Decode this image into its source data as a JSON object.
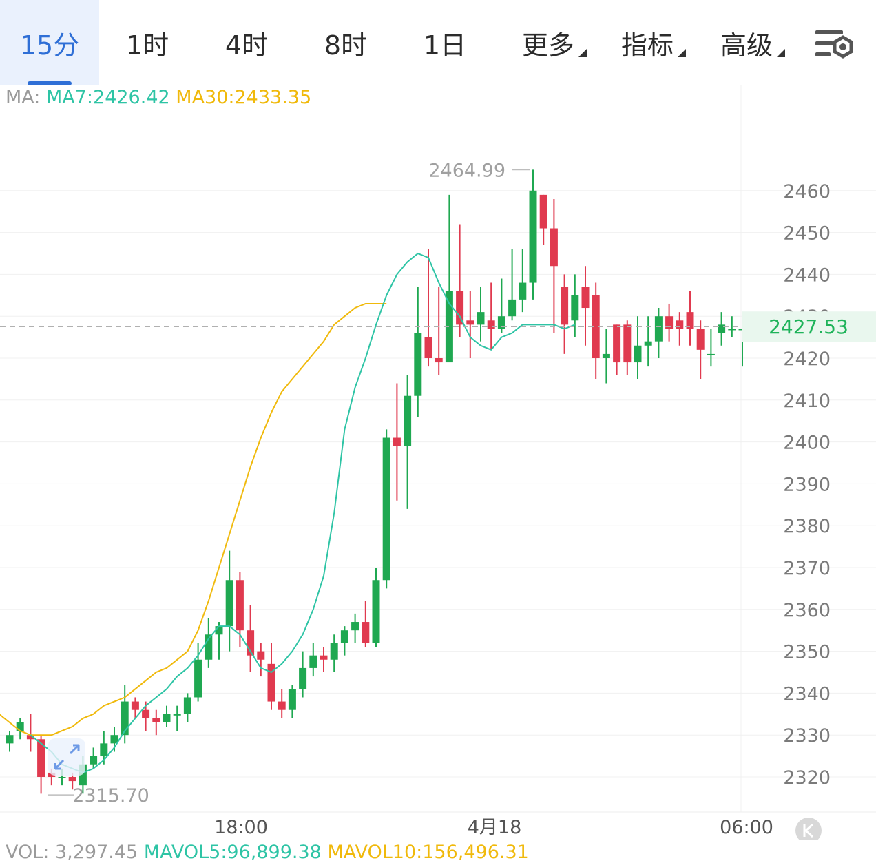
{
  "tabs": [
    {
      "label": "15分",
      "active": true
    },
    {
      "label": "1时"
    },
    {
      "label": "4时"
    },
    {
      "label": "8时"
    },
    {
      "label": "1日"
    },
    {
      "label": "更多",
      "dropdown": true
    },
    {
      "label": "指标",
      "dropdown": true
    },
    {
      "label": "高级",
      "dropdown": true
    }
  ],
  "settings_icon": "chart-settings-icon",
  "ma": {
    "prefix": "MA:",
    "ma7": "MA7:2426.42",
    "ma30": "MA30:2433.35"
  },
  "vol": {
    "vol": "VOL: 3,297.45",
    "mavol5": "MAVOL5:96,899.38",
    "mavol10": "MAVOL10:156,496.31"
  },
  "colors": {
    "up": "#1fa851",
    "down": "#e03a4f",
    "ma7": "#2ec4a5",
    "ma30": "#f0b90b",
    "accent": "#2f6fd6"
  },
  "chart_data": {
    "type": "candlestick",
    "interval": "15分",
    "ylim": [
      2312,
      2476
    ],
    "y_ticks": [
      "2460",
      "2450",
      "2440",
      "2430",
      "2420",
      "2410",
      "2400",
      "2390",
      "2380",
      "2370",
      "2360",
      "2350",
      "2340",
      "2330",
      "2320"
    ],
    "x_labels": [
      "18:00",
      "4月18",
      "06:00"
    ],
    "high_annotation": "2464.99",
    "low_annotation": "2315.70",
    "current_price": "2427.53",
    "candles": [
      [
        2328,
        2330,
        2326,
        2331
      ],
      [
        2331,
        2333,
        2329,
        2334
      ],
      [
        2330,
        2329,
        2326,
        2335
      ],
      [
        2329,
        2320,
        2316,
        2330
      ],
      [
        2321,
        2320,
        2318,
        2322
      ],
      [
        2320,
        2320,
        2318,
        2322
      ],
      [
        2320,
        2319,
        2317,
        2321
      ],
      [
        2318,
        2323,
        2316,
        2325
      ],
      [
        2323,
        2325,
        2322,
        2327
      ],
      [
        2325,
        2328,
        2323,
        2331
      ],
      [
        2328,
        2330,
        2326,
        2332
      ],
      [
        2330,
        2338,
        2328,
        2342
      ],
      [
        2338,
        2336,
        2334,
        2339
      ],
      [
        2336,
        2334,
        2331,
        2338
      ],
      [
        2334,
        2333,
        2330,
        2336
      ],
      [
        2333,
        2335,
        2332,
        2337
      ],
      [
        2335,
        2335,
        2331,
        2337
      ],
      [
        2335,
        2339,
        2333,
        2340
      ],
      [
        2339,
        2348,
        2338,
        2352
      ],
      [
        2348,
        2354,
        2346,
        2358
      ],
      [
        2354,
        2356,
        2348,
        2357
      ],
      [
        2356,
        2367,
        2350,
        2374
      ],
      [
        2367,
        2355,
        2351,
        2369
      ],
      [
        2355,
        2349,
        2345,
        2361
      ],
      [
        2350,
        2348,
        2344,
        2352
      ],
      [
        2347,
        2338,
        2336,
        2352
      ],
      [
        2338,
        2336,
        2334,
        2341
      ],
      [
        2336,
        2341,
        2334,
        2342
      ],
      [
        2341,
        2346,
        2339,
        2350
      ],
      [
        2346,
        2349,
        2344,
        2352
      ],
      [
        2349,
        2348,
        2345,
        2351
      ],
      [
        2348,
        2352,
        2345,
        2354
      ],
      [
        2352,
        2355,
        2349,
        2356
      ],
      [
        2355,
        2357,
        2352,
        2359
      ],
      [
        2357,
        2352,
        2351,
        2362
      ],
      [
        2352,
        2367,
        2351,
        2370
      ],
      [
        2367,
        2401,
        2365,
        2403
      ],
      [
        2401,
        2399,
        2386,
        2414
      ],
      [
        2399,
        2411,
        2384,
        2416
      ],
      [
        2411,
        2426,
        2406,
        2437
      ],
      [
        2425,
        2420,
        2418,
        2446
      ],
      [
        2420,
        2419,
        2416,
        2437
      ],
      [
        2419,
        2436,
        2421,
        2459
      ],
      [
        2436,
        2428,
        2425,
        2452
      ],
      [
        2429,
        2428,
        2420,
        2436
      ],
      [
        2428,
        2431,
        2424,
        2437
      ],
      [
        2429,
        2427,
        2422,
        2438
      ],
      [
        2427,
        2430,
        2426,
        2439
      ],
      [
        2430,
        2434,
        2429,
        2446
      ],
      [
        2434,
        2438,
        2431,
        2446
      ],
      [
        2438,
        2460,
        2434,
        2465
      ],
      [
        2459,
        2451,
        2447,
        2459
      ],
      [
        2451,
        2442,
        2426,
        2458
      ],
      [
        2437,
        2428,
        2421,
        2440
      ],
      [
        2429,
        2435,
        2425,
        2440
      ],
      [
        2437,
        2432,
        2423,
        2442
      ],
      [
        2435,
        2420,
        2415,
        2438
      ],
      [
        2420,
        2421,
        2414,
        2427
      ],
      [
        2428,
        2419,
        2416,
        2428
      ],
      [
        2428,
        2419,
        2416,
        2429
      ],
      [
        2419,
        2423,
        2415,
        2430
      ],
      [
        2423,
        2424,
        2418,
        2430
      ],
      [
        2424,
        2430,
        2420,
        2432
      ],
      [
        2430,
        2427,
        2424,
        2433
      ],
      [
        2429,
        2427,
        2423,
        2431
      ],
      [
        2431,
        2427,
        2423,
        2436
      ],
      [
        2427,
        2422,
        2415,
        2429
      ],
      [
        2421,
        2421,
        2418,
        2427
      ],
      [
        2426,
        2428,
        2423,
        2431
      ],
      [
        2427,
        2427,
        2425,
        2430
      ],
      [
        2427,
        2427,
        2418,
        2428
      ],
      [
        2427,
        2427,
        2426,
        2428
      ]
    ],
    "ma7": [
      2330,
      2328,
      2326,
      2323,
      2322,
      2321,
      2322,
      2324,
      2327,
      2331,
      2334,
      2337,
      2339,
      2341,
      2344,
      2346,
      2349,
      2353,
      2356,
      2356,
      2354,
      2350,
      2346,
      2345,
      2347,
      2350,
      2354,
      2360,
      2368,
      2383,
      2403,
      2413,
      2420,
      2428,
      2435,
      2440,
      2443,
      2445,
      2444,
      2438,
      2433,
      2430,
      2425,
      2423,
      2422,
      2425,
      2426,
      2428,
      2428,
      2428,
      2428,
      2427,
      2428
    ],
    "ma7_start": 2,
    "ma30": [
      2337,
      2335,
      2333,
      2331,
      2330,
      2330,
      2330,
      2331,
      2332,
      2334,
      2335,
      2337,
      2338,
      2339,
      2341,
      2343,
      2345,
      2346,
      2348,
      2350,
      2355,
      2362,
      2370,
      2378,
      2386,
      2394,
      2401,
      2407,
      2412,
      2415,
      2418,
      2421,
      2424,
      2428,
      2430,
      2432,
      2433,
      2433,
      2433
    ],
    "ma30_start": -2
  }
}
